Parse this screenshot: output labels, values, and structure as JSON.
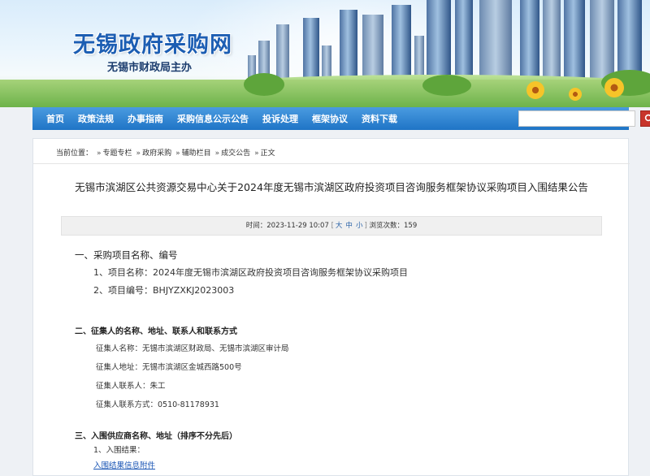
{
  "header": {
    "site_title": "无锡政府采购网",
    "site_subtitle": "无锡市财政局主办"
  },
  "nav": {
    "items": [
      "首页",
      "政策法规",
      "办事指南",
      "采购信息公示公告",
      "投诉处理",
      "框架协议",
      "资料下载"
    ],
    "search_value": "",
    "search_icon": "search-icon"
  },
  "breadcrumb": {
    "prefix": "当前位置：",
    "items": [
      "专题专栏",
      "政府采购",
      "辅助栏目",
      "成交公告",
      "正文"
    ],
    "separator": "»"
  },
  "article": {
    "title": "无锡市滨湖区公共资源交易中心关于2024年度无锡市滨湖区政府投资项目咨询服务框架协议采购项目入围结果公告",
    "meta_time_label": "时间：",
    "meta_time": "2023-11-29 10:07",
    "font_open": "[",
    "font_large": "大",
    "font_medium": "中",
    "font_small": "小",
    "font_close": "]",
    "views_label": "浏览次数：",
    "views": "159",
    "sections": {
      "s1_heading": "一、采购项目名称、编号",
      "s1_line1": "1、项目名称：2024年度无锡市滨湖区政府投资项目咨询服务框架协议采购项目",
      "s1_line2": "2、项目编号：BHJYZXKJ2023003",
      "s2_heading": "二、征集人的名称、地址、联系人和联系方式",
      "s2_line1": "征集人名称：无锡市滨湖区财政局、无锡市滨湖区审计局",
      "s2_line2": "征集人地址：无锡市滨湖区金城西路500号",
      "s2_line3": "征集人联系人：朱工",
      "s2_line4": "征集人联系方式：0510-81178931",
      "s3_heading": "三、入围供应商名称、地址（排序不分先后）",
      "s3_line1": "1、入围结果：",
      "s3_link": "入围结果信息附件"
    }
  }
}
